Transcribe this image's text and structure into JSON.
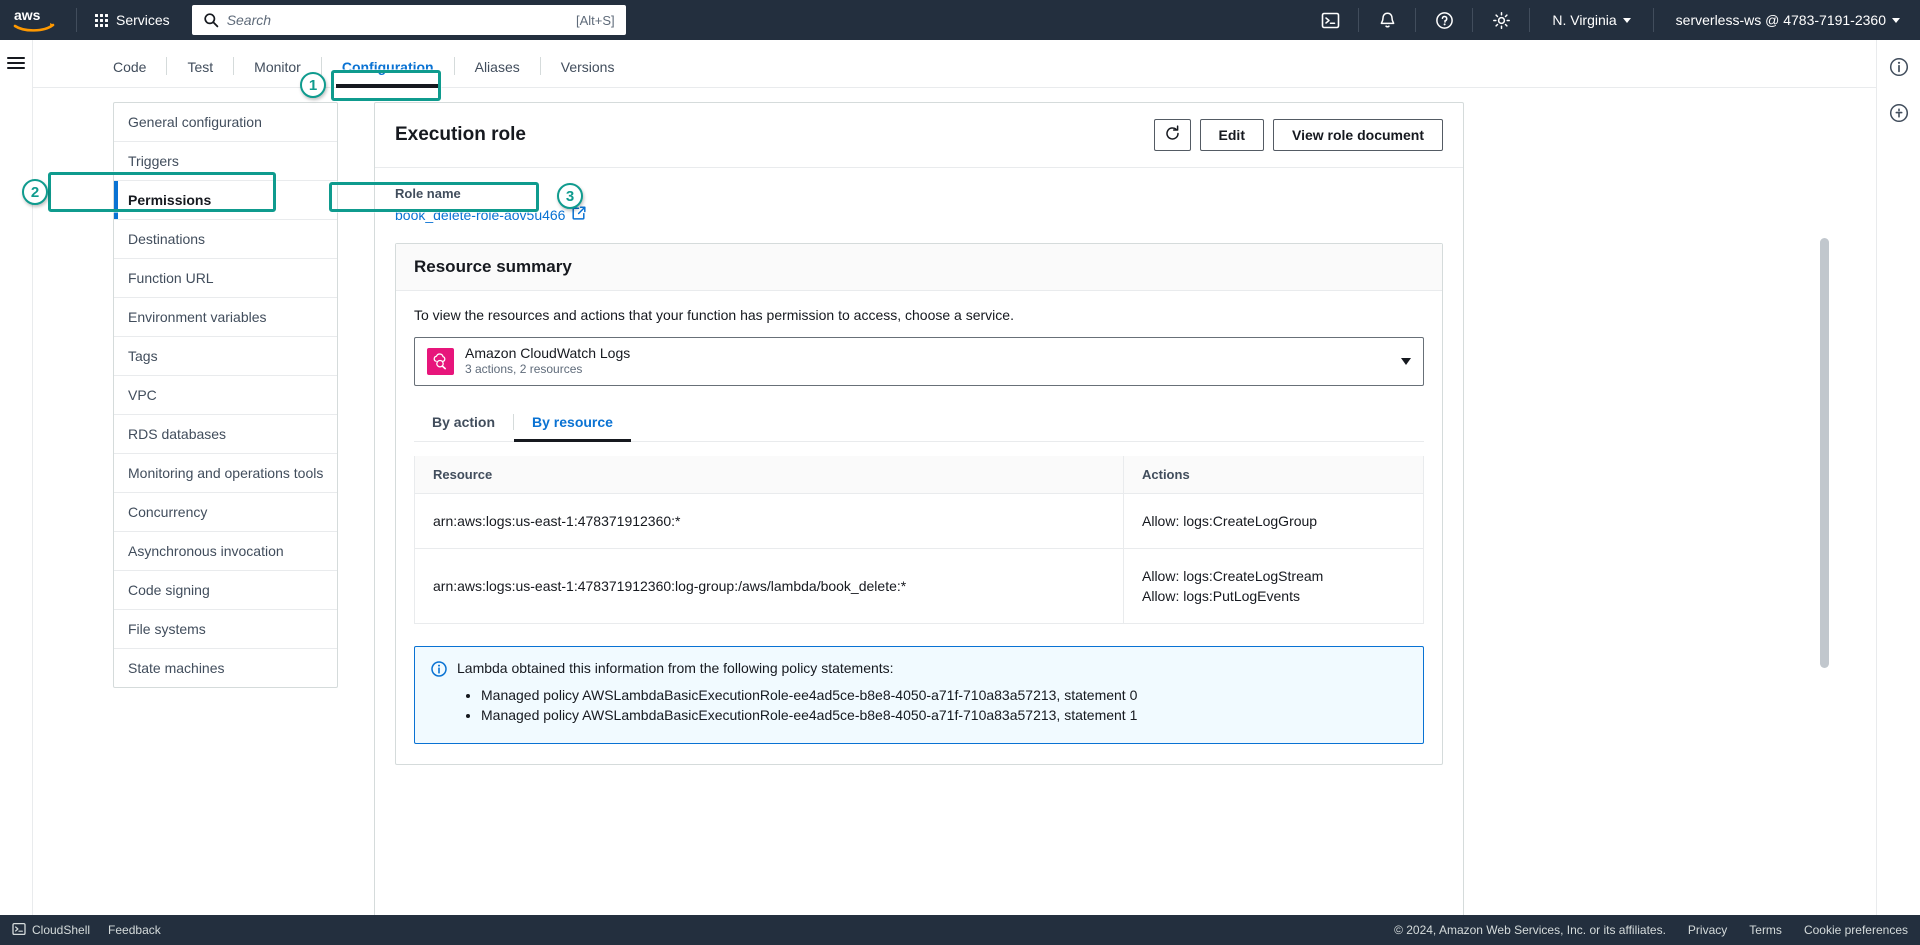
{
  "topnav": {
    "logo_alt": "aws",
    "services_label": "Services",
    "search_placeholder": "Search",
    "search_value": "",
    "search_shortcut": "[Alt+S]",
    "region_label": "N. Virginia",
    "account_label": "serverless-ws @ 4783-7191-2360",
    "icons": [
      "cloudshell-icon",
      "notifications-bell-icon",
      "help-question-icon",
      "settings-gear-icon"
    ]
  },
  "tabs": [
    {
      "label": "Code",
      "active": false
    },
    {
      "label": "Test",
      "active": false
    },
    {
      "label": "Monitor",
      "active": false
    },
    {
      "label": "Configuration",
      "active": true
    },
    {
      "label": "Aliases",
      "active": false
    },
    {
      "label": "Versions",
      "active": false
    }
  ],
  "config_nav": [
    {
      "label": "General configuration",
      "active": false
    },
    {
      "label": "Triggers",
      "active": false
    },
    {
      "label": "Permissions",
      "active": true
    },
    {
      "label": "Destinations",
      "active": false
    },
    {
      "label": "Function URL",
      "active": false
    },
    {
      "label": "Environment variables",
      "active": false
    },
    {
      "label": "Tags",
      "active": false
    },
    {
      "label": "VPC",
      "active": false
    },
    {
      "label": "RDS databases",
      "active": false
    },
    {
      "label": "Monitoring and operations tools",
      "active": false
    },
    {
      "label": "Concurrency",
      "active": false
    },
    {
      "label": "Asynchronous invocation",
      "active": false
    },
    {
      "label": "Code signing",
      "active": false
    },
    {
      "label": "File systems",
      "active": false
    },
    {
      "label": "State machines",
      "active": false
    }
  ],
  "panel": {
    "title": "Execution role",
    "refresh_label": "refresh-icon",
    "edit_label": "Edit",
    "view_role_document_label": "View role document",
    "role_name_label": "Role name",
    "role_name_value": "book_delete-role-aov5u466"
  },
  "resource_summary": {
    "title": "Resource summary",
    "description": "To view the resources and actions that your function has permission to access, choose a service.",
    "selected_service": {
      "name": "Amazon CloudWatch Logs",
      "meta": "3 actions, 2 resources",
      "icon_color": "#e7157b"
    },
    "subtabs": [
      {
        "label": "By action",
        "active": false
      },
      {
        "label": "By resource",
        "active": true
      }
    ],
    "table": {
      "columns": [
        "Resource",
        "Actions"
      ],
      "rows": [
        {
          "resource": "arn:aws:logs:us-east-1:478371912360:*",
          "actions": [
            "Allow: logs:CreateLogGroup"
          ]
        },
        {
          "resource": "arn:aws:logs:us-east-1:478371912360:log-group:/aws/lambda/book_delete:*",
          "actions": [
            "Allow: logs:CreateLogStream",
            "Allow: logs:PutLogEvents"
          ]
        }
      ]
    },
    "info": {
      "heading": "Lambda obtained this information from the following policy statements:",
      "items": [
        "Managed policy AWSLambdaBasicExecutionRole-ee4ad5ce-b8e8-4050-a71f-710a83a57213, statement 0",
        "Managed policy AWSLambdaBasicExecutionRole-ee4ad5ce-b8e8-4050-a71f-710a83a57213, statement 1"
      ]
    }
  },
  "annotations": [
    {
      "number": "1",
      "target": "tab-configuration"
    },
    {
      "number": "2",
      "target": "config-nav-permissions"
    },
    {
      "number": "3",
      "target": "role-name-link"
    }
  ],
  "footer": {
    "cloudshell_label": "CloudShell",
    "feedback_label": "Feedback",
    "copyright": "© 2024, Amazon Web Services, Inc. or its affiliates.",
    "privacy_label": "Privacy",
    "terms_label": "Terms",
    "cookie_label": "Cookie preferences"
  },
  "colors": {
    "accent_blue": "#0972d3",
    "nav_dark": "#232f3e",
    "annotation_teal": "#0f9b8e",
    "cloudwatch_pink": "#e7157b"
  }
}
